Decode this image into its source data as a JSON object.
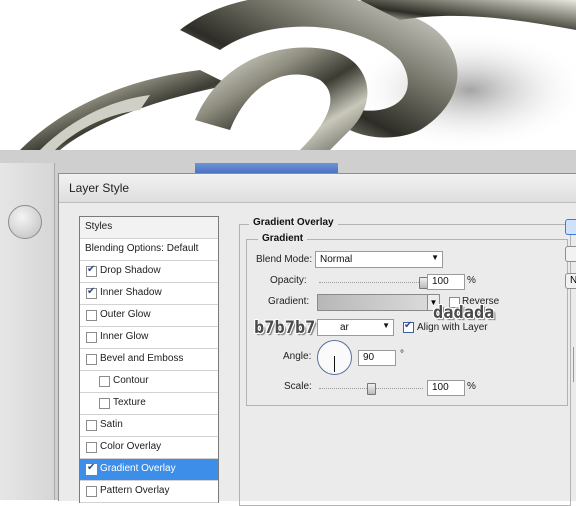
{
  "dialog": {
    "title": "Layer Style"
  },
  "styles": {
    "header": "Styles",
    "items": [
      {
        "label": "Blending Options: Default",
        "has_checkbox": false,
        "checked": false,
        "indent": false,
        "selected": false
      },
      {
        "label": "Drop Shadow",
        "has_checkbox": true,
        "checked": true,
        "indent": false,
        "selected": false
      },
      {
        "label": "Inner Shadow",
        "has_checkbox": true,
        "checked": true,
        "indent": false,
        "selected": false
      },
      {
        "label": "Outer Glow",
        "has_checkbox": true,
        "checked": false,
        "indent": false,
        "selected": false
      },
      {
        "label": "Inner Glow",
        "has_checkbox": true,
        "checked": false,
        "indent": false,
        "selected": false
      },
      {
        "label": "Bevel and Emboss",
        "has_checkbox": true,
        "checked": false,
        "indent": false,
        "selected": false
      },
      {
        "label": "Contour",
        "has_checkbox": true,
        "checked": false,
        "indent": true,
        "selected": false
      },
      {
        "label": "Texture",
        "has_checkbox": true,
        "checked": false,
        "indent": true,
        "selected": false
      },
      {
        "label": "Satin",
        "has_checkbox": true,
        "checked": false,
        "indent": false,
        "selected": false
      },
      {
        "label": "Color Overlay",
        "has_checkbox": true,
        "checked": false,
        "indent": false,
        "selected": false
      },
      {
        "label": "Gradient Overlay",
        "has_checkbox": true,
        "checked": true,
        "indent": false,
        "selected": true
      },
      {
        "label": "Pattern Overlay",
        "has_checkbox": true,
        "checked": false,
        "indent": false,
        "selected": false
      }
    ]
  },
  "gradient_overlay": {
    "section_title": "Gradient Overlay",
    "group_title": "Gradient",
    "blend_mode_label": "Blend Mode:",
    "blend_mode_value": "Normal",
    "opacity_label": "Opacity:",
    "opacity_value": "100",
    "opacity_unit": "%",
    "opacity_level": 1.0,
    "gradient_label": "Gradient:",
    "gradient_start_color": "#b7b7b7",
    "gradient_end_color": "#dadada",
    "reverse_label": "Reverse",
    "reverse_checked": false,
    "style_value": "ar",
    "align_label": "Align with Layer",
    "align_checked": true,
    "angle_label": "Angle:",
    "angle_value": "90",
    "angle_unit": "°",
    "scale_label": "Scale:",
    "scale_value": "100",
    "scale_unit": "%",
    "scale_level": 0.5
  },
  "annotations": {
    "left_color": "b7b7b7",
    "right_color": "dadada"
  },
  "colors": {
    "selection": "#3d8ee9",
    "dialog_bg": "#ebebeb",
    "chrome": "#b7b7b7"
  },
  "icons": {
    "checkbox_checked": "check-icon",
    "dropdown": "chevron-down-icon"
  }
}
